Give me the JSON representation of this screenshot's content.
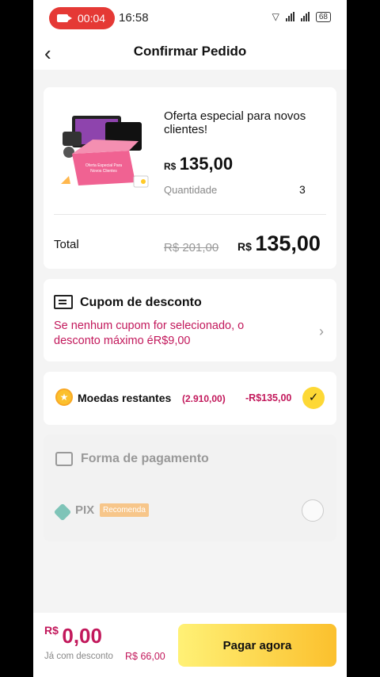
{
  "status_bar": {
    "record_time": "00:04",
    "clock": "16:58",
    "battery": "68"
  },
  "header": {
    "title": "Confirmar Pedido"
  },
  "product": {
    "title": "Oferta especial para novos clientes!",
    "price_currency": "R$",
    "price_value": "135,00",
    "quantity_label": "Quantidade",
    "quantity_value": "3",
    "image_caption": "Oferta Especial Para Novos Clientes"
  },
  "total": {
    "label": "Total",
    "old_price": "R$ 201,00",
    "currency": "R$",
    "value": "135,00"
  },
  "coupon": {
    "title": "Cupom de desconto",
    "description": "Se nenhum cupom for selecionado, o desconto máximo éR$9,00"
  },
  "coins": {
    "label": "Moedas restantes",
    "count": "(2.910,00)",
    "discount": "-R$135,00",
    "checked": true
  },
  "payment": {
    "title": "Forma de pagamento",
    "method": "PIX",
    "badge": "Recomenda"
  },
  "footer": {
    "currency": "R$",
    "amount": "0,00",
    "discount_label": "Já com desconto",
    "discount_value": "R$ 66,00",
    "pay_button": "Pagar agora"
  },
  "colors": {
    "accent": "#c2185b",
    "button": "#fbc02d",
    "record": "#e53935"
  }
}
